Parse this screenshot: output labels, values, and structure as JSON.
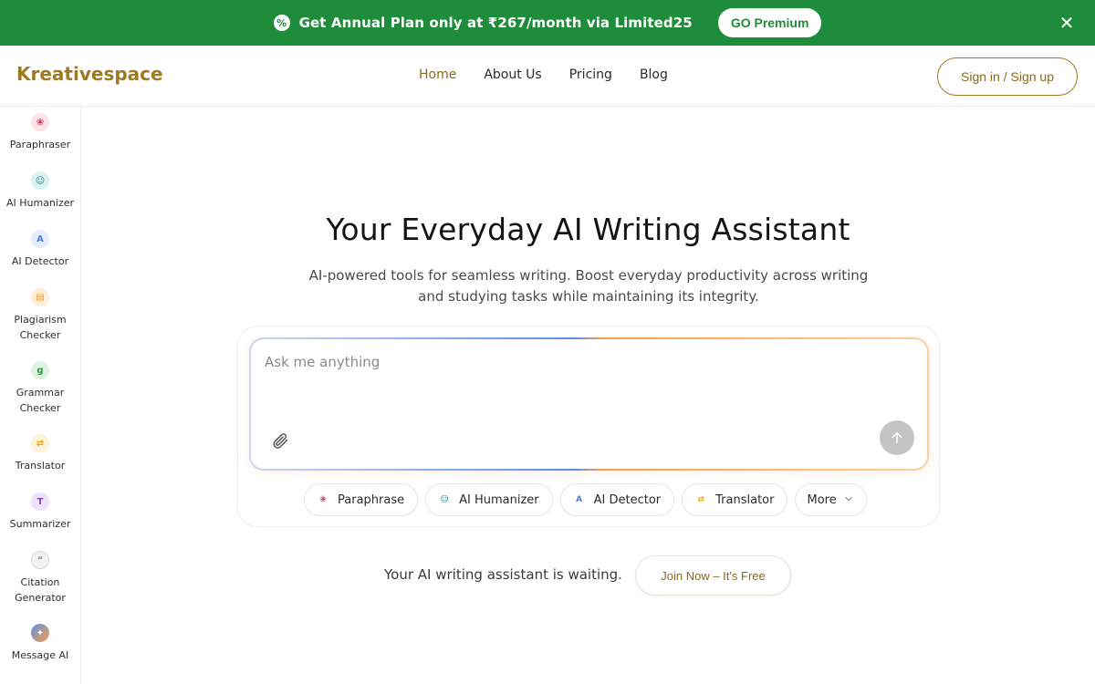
{
  "promo": {
    "text": "Get Annual Plan only at ₹267/month via Limited25",
    "button_label": "GO Premium",
    "close_glyph": "✕",
    "badge_glyph": "%",
    "bg_color": "#1e8c3a"
  },
  "header": {
    "logo": "Kreativespace",
    "nav": [
      {
        "label": "Home",
        "active": true
      },
      {
        "label": "About Us",
        "active": false
      },
      {
        "label": "Pricing",
        "active": false
      },
      {
        "label": "Blog",
        "active": false
      }
    ],
    "signin_label": "Sign in / Sign up",
    "accent_color": "#a07a1e"
  },
  "sidebar": {
    "items": [
      {
        "label": "Paraphraser",
        "icon": "paraphraser-icon"
      },
      {
        "label": "AI Humanizer",
        "icon": "humanizer-icon"
      },
      {
        "label": "AI Detector",
        "icon": "ai-detector-icon"
      },
      {
        "label": "Plagiarism\nChecker",
        "icon": "plagiarism-icon"
      },
      {
        "label": "Grammar\nChecker",
        "icon": "grammar-icon"
      },
      {
        "label": "Translator",
        "icon": "translator-icon"
      },
      {
        "label": "Summarizer",
        "icon": "summarizer-icon"
      },
      {
        "label": "Citation\nGenerator",
        "icon": "citation-icon"
      },
      {
        "label": "Message AI",
        "icon": "message-ai-icon"
      }
    ]
  },
  "hero": {
    "title": "Your Everyday AI Writing Assistant",
    "subtitle": "AI-powered tools for seamless writing. Boost everyday productivity across writing and studying tasks while maintaining its integrity."
  },
  "chat": {
    "placeholder": "Ask me anything",
    "chips": [
      {
        "label": "Paraphrase",
        "icon": "paraphrase-icon"
      },
      {
        "label": "AI Humanizer",
        "icon": "humanizer-icon"
      },
      {
        "label": "AI Detector",
        "icon": "ai-detector-icon"
      },
      {
        "label": "Translator",
        "icon": "translator-icon"
      },
      {
        "label": "More",
        "icon": "chevron-down-icon"
      }
    ]
  },
  "footer_cta": {
    "text": "Your AI writing assistant is waiting.",
    "button_label": "Join Now – It's Free"
  }
}
